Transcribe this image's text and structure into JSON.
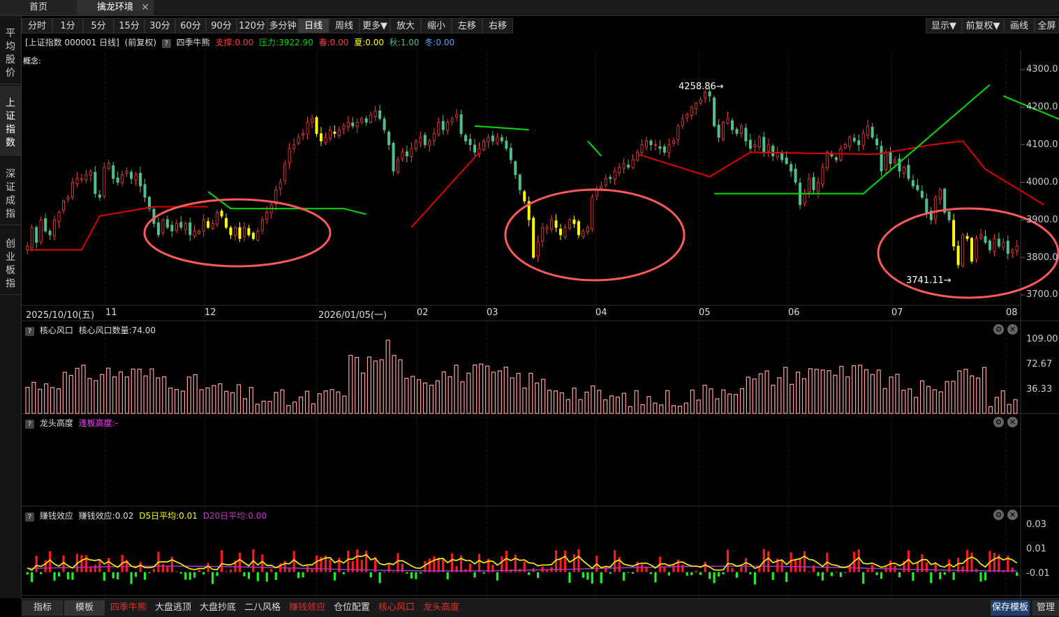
{
  "tabs": {
    "home": "首页",
    "env": "擒龙环境",
    "close": "✕"
  },
  "leftnav": [
    "平均股价",
    "上证指数",
    "深证成指",
    "创业板指"
  ],
  "toolbar": {
    "periods": [
      "分时",
      "1分",
      "5分",
      "15分",
      "30分",
      "60分",
      "90分",
      "120分",
      "多分钟",
      "日线",
      "周线",
      "更多▼",
      "放大",
      "缩小",
      "左移",
      "右移"
    ],
    "right": [
      "显示▼",
      "前复权▼",
      "画线",
      "全屏"
    ]
  },
  "info": {
    "security": "[上证指数 000001 日线]",
    "adjust": "(前复权)",
    "indicator": "四季牛熊",
    "support": "支撑:0.00",
    "pressure": "压力:3922.90",
    "spring": "春:0.00",
    "summer": "夏:0.00",
    "autumn": "秋:1.00",
    "winter": "冬:0.00"
  },
  "concept_label": "概念:",
  "annotations": {
    "high": "4258.86",
    "low": "3741.11"
  },
  "main_axis": [
    "4300.0",
    "4200.0",
    "4100.0",
    "4000.0",
    "3900.0",
    "3800.0",
    "3700.0"
  ],
  "date_axis": [
    {
      "label": "2025/10/10(五)"
    },
    {
      "label": "11"
    },
    {
      "label": "12"
    },
    {
      "label": "2026/01/05(一)"
    },
    {
      "label": "02"
    },
    {
      "label": "03"
    },
    {
      "label": "04"
    },
    {
      "label": "05"
    },
    {
      "label": "06"
    },
    {
      "label": "07"
    },
    {
      "label": "08"
    }
  ],
  "panel1": {
    "name": "核心风口",
    "value": "核心风口数量:74.00",
    "axis": [
      "109.00",
      "72.67",
      "36.33"
    ]
  },
  "panel2": {
    "name": "龙头高度",
    "value": "连板高度:-"
  },
  "panel3": {
    "name": "赚钱效应",
    "value": "赚钱效应:0.02",
    "d5": "D5日平均:0.01",
    "d20": "D20日平均:0.00",
    "axis": [
      "0.03",
      "0.01",
      "-0.01"
    ]
  },
  "bottom": {
    "left": [
      "指标",
      "模板"
    ],
    "items": [
      "四季牛熊",
      "大盘逃顶",
      "大盘抄底",
      "二八风格",
      "赚钱效应",
      "仓位配置",
      "核心风口",
      "龙头高度"
    ],
    "right": [
      "保存模板",
      "管理"
    ]
  },
  "colors": {
    "up": "#ff3b3b",
    "down": "#4fc08d",
    "yellow": "#ffff00",
    "support": "#e00000",
    "pressure": "#00dd00",
    "volume": "#ffa0a0",
    "circle": "#ff5a5a"
  },
  "chart_data": {
    "type": "candlestick",
    "ylim": [
      3700,
      4300
    ],
    "close": [
      3830,
      3880,
      3840,
      3900,
      3870,
      3860,
      3900,
      3920,
      3950,
      3960,
      4000,
      4010,
      4010,
      4020,
      4030,
      3970,
      3960,
      4040,
      4050,
      4010,
      4000,
      4020,
      4030,
      4010,
      4020,
      3990,
      3960,
      3930,
      3890,
      3860,
      3900,
      3880,
      3870,
      3890,
      3880,
      3890,
      3860,
      3870,
      3870,
      3900,
      3880,
      3890,
      3920,
      3910,
      3880,
      3860,
      3880,
      3850,
      3880,
      3860,
      3850,
      3870,
      3900,
      3920,
      3940,
      3980,
      4000,
      4050,
      4090,
      4100,
      4120,
      4130,
      4160,
      4170,
      4130,
      4110,
      4120,
      4140,
      4130,
      4140,
      4150,
      4160,
      4150,
      4160,
      4170,
      4160,
      4180,
      4190,
      4170,
      4140,
      4100,
      4030,
      4060,
      4080,
      4070,
      4090,
      4110,
      4120,
      4100,
      4110,
      4130,
      4160,
      4140,
      4160,
      4170,
      4180,
      4130,
      4110,
      4100,
      4080,
      4090,
      4110,
      4120,
      4110,
      4120,
      4110,
      4090,
      4060,
      4020,
      3980,
      3950,
      3900,
      3800,
      3840,
      3880,
      3880,
      3900,
      3880,
      3860,
      3880,
      3900,
      3890,
      3860,
      3870,
      3880,
      3960,
      3980,
      3990,
      4010,
      4010,
      4030,
      4040,
      4050,
      4040,
      4060,
      4080,
      4100,
      4110,
      4100,
      4100,
      4090,
      4080,
      4100,
      4110,
      4150,
      4170,
      4180,
      4200,
      4210,
      4220,
      4240,
      4230,
      4150,
      4120,
      4160,
      4170,
      4140,
      4130,
      4150,
      4110,
      4090,
      4100,
      4120,
      4080,
      4100,
      4070,
      4080,
      4060,
      4050,
      4030,
      4000,
      3940,
      3970,
      4010,
      3980,
      4000,
      4040,
      4080,
      4070,
      4060,
      4090,
      4100,
      4120,
      4110,
      4100,
      4130,
      4150,
      4120,
      4100,
      4030,
      4080,
      4050,
      4060,
      4030,
      4040,
      4010,
      3990,
      3980,
      3960,
      3920,
      3900,
      3960,
      3980,
      3920,
      3900,
      3830,
      3780,
      3860,
      3850,
      3790,
      3850,
      3860,
      3840,
      3820,
      3850,
      3830,
      3840,
      3810,
      3820,
      3830
    ],
    "support": [
      [
        0,
        3820
      ],
      [
        12,
        3820
      ],
      [
        16,
        3910
      ],
      [
        28,
        3935
      ],
      [
        33,
        3935
      ],
      [
        40,
        3935
      ],
      [
        72,
        3820
      ],
      [
        85,
        3880
      ],
      [
        100,
        4080
      ],
      [
        135,
        4075
      ],
      [
        151,
        4015
      ],
      [
        160,
        4080
      ],
      [
        186,
        4075
      ],
      [
        188,
        4075
      ],
      [
        200,
        4100
      ],
      [
        207,
        4110
      ],
      [
        212,
        4035
      ],
      [
        225,
        3940
      ],
      [
        237,
        3980
      ],
      [
        240,
        3940
      ],
      [
        243,
        3950
      ],
      [
        250,
        3980
      ],
      [
        278,
        4030
      ],
      [
        290,
        4040
      ],
      [
        313,
        3990
      ],
      [
        330,
        4010
      ],
      [
        336,
        3950
      ],
      [
        338,
        3980
      ]
    ],
    "pressure": [
      [
        40,
        3975
      ],
      [
        45,
        3930
      ],
      [
        70,
        3930
      ],
      [
        75,
        3915
      ],
      [
        99,
        4150
      ],
      [
        111,
        4140
      ],
      [
        124,
        4110
      ],
      [
        127,
        4070
      ],
      [
        152,
        3970
      ],
      [
        160,
        3970
      ],
      [
        185,
        3970
      ],
      [
        213,
        4260
      ],
      [
        216,
        4230
      ],
      [
        240,
        4110
      ],
      [
        244,
        4080
      ],
      [
        254,
        4030
      ],
      [
        267,
        4110
      ],
      [
        273,
        4025
      ],
      [
        279,
        4070
      ],
      [
        283,
        4025
      ],
      [
        288,
        4000
      ],
      [
        309,
        3955
      ],
      [
        317,
        3975
      ],
      [
        330,
        3965
      ]
    ],
    "volume_max": 109.0,
    "effect_range": [
      -0.02,
      0.04
    ]
  }
}
